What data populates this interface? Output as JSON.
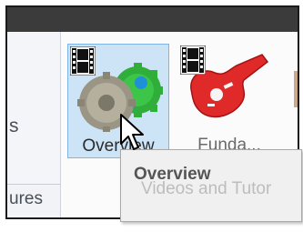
{
  "left_panel": {
    "partial_label": "s",
    "bottom_label": "ures"
  },
  "gallery": {
    "items": [
      {
        "label": "Overview",
        "icon": "film-strip-icon",
        "thumbnail": "gears-thumbnail",
        "selected": true
      },
      {
        "label": "Funda...",
        "icon": "film-strip-icon",
        "thumbnail": "red-guitar-thumbnail",
        "selected": false
      }
    ]
  },
  "tooltip": {
    "title": "Overview",
    "description": "Videos and Tutor"
  },
  "colors": {
    "selection_fill": "#cde4f7",
    "selection_border": "#7eb4ea",
    "titlebar": "#3b3b3b",
    "guitar_red": "#e02a2a",
    "gear_green": "#2fae3a"
  }
}
